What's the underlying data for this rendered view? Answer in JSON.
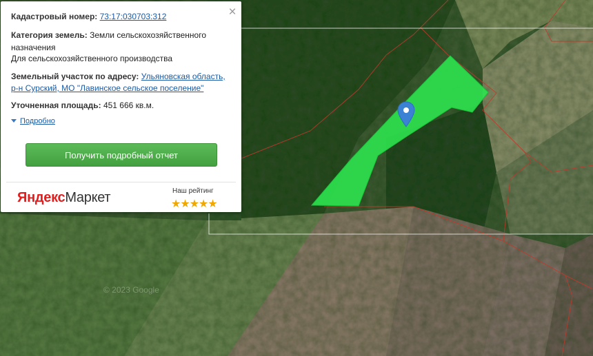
{
  "map": {
    "watermark": "© 2023 Google"
  },
  "popup": {
    "close_label": "×",
    "cadastral": {
      "label": "Кадастровый номер:",
      "value": "73:17:030703:312"
    },
    "category": {
      "label": "Категория земель:",
      "value_line1": "Земли сельскохозяйственного",
      "value_line2": "назначения",
      "value_line3": "Для сельскохозяйственного производства"
    },
    "address": {
      "label": "Земельный участок по адресу:",
      "value_line1": "Ульяновская область,",
      "value_line2": "р-н Сурский, МО \"Лавинское сельское поселение\""
    },
    "area": {
      "label": "Уточненная площадь:",
      "value": "451 666 кв.м."
    },
    "more_label": "Подробно",
    "report_button": "Получить подробный отчет",
    "logo": {
      "part1": "Яндекс",
      "part2": "Маркет"
    },
    "rating": {
      "label": "Наш рейтинг",
      "stars": "★★★★★",
      "value": 5
    }
  },
  "colors": {
    "parcel": "#2ee34f",
    "button": "#4caf50",
    "marker": "#3b82d4",
    "boundary": "#c0392b"
  }
}
